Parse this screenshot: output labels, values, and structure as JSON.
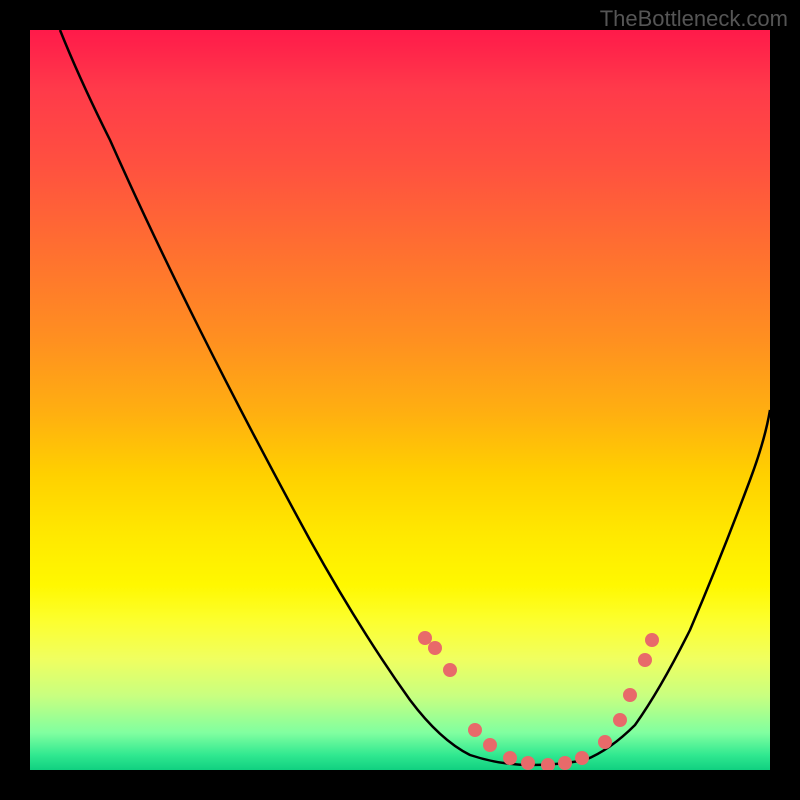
{
  "watermark": "TheBottleneck.com",
  "chart_data": {
    "type": "line",
    "title": "",
    "xlabel": "",
    "ylabel": "",
    "xlim": [
      0,
      100
    ],
    "ylim": [
      0,
      100
    ],
    "series": [
      {
        "name": "bottleneck-curve",
        "x": [
          5,
          10,
          15,
          20,
          25,
          30,
          35,
          40,
          45,
          50,
          55,
          60,
          63,
          66,
          70,
          75,
          80,
          85,
          90,
          95,
          100
        ],
        "y": [
          100,
          92,
          84,
          76,
          68,
          60,
          52,
          44,
          36,
          28,
          20,
          12,
          6,
          3,
          1,
          1,
          3,
          8,
          18,
          32,
          48
        ]
      }
    ],
    "markers": {
      "name": "data-points",
      "x": [
        55,
        56,
        58,
        62,
        64,
        67,
        69,
        72,
        74,
        76,
        79,
        81,
        82,
        84
      ],
      "y": [
        18,
        16,
        12,
        6,
        4,
        2,
        1,
        1,
        1,
        2,
        4,
        7,
        10,
        14
      ],
      "color": "#e86a6a"
    },
    "colors": {
      "curve": "#000000",
      "markers": "#e86a6a",
      "background_top": "#ff1a4a",
      "background_bottom": "#10d080"
    }
  }
}
